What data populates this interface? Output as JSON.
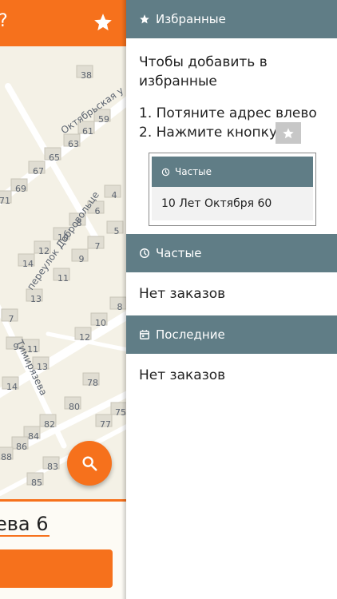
{
  "map": {
    "topbar_title_fragment": "?",
    "streets": [
      "Октябрьская у",
      "переулок Добровольце",
      "Тимирязева"
    ],
    "house_numbers": [
      {
        "n": "38"
      },
      {
        "n": "59"
      },
      {
        "n": "61"
      },
      {
        "n": "63"
      },
      {
        "n": "65"
      },
      {
        "n": "67"
      },
      {
        "n": "69"
      },
      {
        "n": "71"
      },
      {
        "n": "4"
      },
      {
        "n": "6"
      },
      {
        "n": "8"
      },
      {
        "n": "10"
      },
      {
        "n": "12"
      },
      {
        "n": "14"
      },
      {
        "n": "5"
      },
      {
        "n": "7"
      },
      {
        "n": "9"
      },
      {
        "n": "11"
      },
      {
        "n": "13"
      },
      {
        "n": "8"
      },
      {
        "n": "7"
      },
      {
        "n": "10"
      },
      {
        "n": "12"
      },
      {
        "n": "9"
      },
      {
        "n": "11"
      },
      {
        "n": "13"
      },
      {
        "n": "14"
      },
      {
        "n": "78"
      },
      {
        "n": "80"
      },
      {
        "n": "75"
      },
      {
        "n": "77"
      },
      {
        "n": "82"
      },
      {
        "n": "84"
      },
      {
        "n": "86"
      },
      {
        "n": "88"
      },
      {
        "n": "83"
      },
      {
        "n": "85"
      }
    ],
    "address_fragment": "ева 6"
  },
  "drawer": {
    "favorites": {
      "title": "Избранные",
      "instruction_line": "Чтобы добавить в избранные",
      "step1": "1. Потяните адрес влево",
      "step2": "2. Нажмите кнопку",
      "example_card": {
        "header": "Частые",
        "address": "10 Лет Октября 60"
      }
    },
    "frequent": {
      "title": "Частые",
      "empty": "Нет заказов"
    },
    "recent": {
      "title": "Последние",
      "empty": "Нет заказов"
    }
  },
  "colors": {
    "accent": "#f6711c",
    "header": "#607d86",
    "map_bg": "#f4f1e6"
  }
}
